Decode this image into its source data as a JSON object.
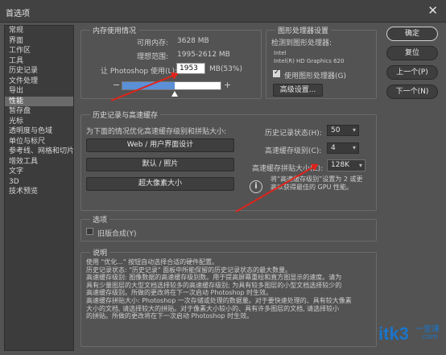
{
  "window": {
    "title": "首选项",
    "close_icon": "close-icon"
  },
  "sidebar": {
    "items": [
      {
        "label": "常规",
        "selected": false
      },
      {
        "label": "界面",
        "selected": false
      },
      {
        "label": "工作区",
        "selected": false
      },
      {
        "label": "工具",
        "selected": false
      },
      {
        "label": "历史记录",
        "selected": false
      },
      {
        "label": "文件处理",
        "selected": false
      },
      {
        "label": "导出",
        "selected": false
      },
      {
        "label": "性能",
        "selected": true
      },
      {
        "label": "暂存盘",
        "selected": false
      },
      {
        "label": "光标",
        "selected": false
      },
      {
        "label": "透明度与色域",
        "selected": false
      },
      {
        "label": "单位与标尺",
        "selected": false
      },
      {
        "label": "参考线、网格和切片",
        "selected": false
      },
      {
        "label": "增效工具",
        "selected": false
      },
      {
        "label": "文字",
        "selected": false
      },
      {
        "label": "3D",
        "selected": false
      },
      {
        "label": "技术预览",
        "selected": false
      }
    ]
  },
  "memory": {
    "legend": "内存使用情况",
    "available_label": "可用内存:",
    "available_value": "3628 MB",
    "ideal_label": "理想范围:",
    "ideal_value": "1995-2612 MB",
    "use_label": "让 Photoshop 使用(L):",
    "use_value": "1953",
    "use_unit": "MB(53%)",
    "minus": "−",
    "plus": "+",
    "slider_fraction": 0.53
  },
  "gpu": {
    "legend": "图形处理器设置",
    "detected_label": "检测到图形处理器:",
    "vendor": "Intel",
    "model": "Intel(R) HD Graphics 620",
    "use_gpu_label": "使用图形处理器(G)",
    "use_gpu_checked": true,
    "advanced_button": "高级设置..."
  },
  "history_cache": {
    "legend": "历史记录与高速缓存",
    "optimize_label": "为下面的情况优化高速缓存级别和拼贴大小:",
    "preset_buttons": [
      "Web / 用户界面设计",
      "默认 / 照片",
      "超大像素大小"
    ],
    "states_label": "历史记录状态(H):",
    "states_value": "50",
    "levels_label": "高速缓存级别(C):",
    "levels_value": "4",
    "tile_label": "高速缓存拼贴大小(Z):",
    "tile_value": "128K",
    "info_text_1": "将“高速缓存级别”设置为 2 或更",
    "info_text_2": "高以获得最佳的 GPU 性能。"
  },
  "options": {
    "legend": "选项",
    "legacy_compositing_label": "旧版合成(Y)",
    "legacy_compositing_checked": false
  },
  "description": {
    "legend": "说明",
    "lines": [
      "使用 \"优化...\" 按钮自动选择合适的硬件配置。",
      "历史记录状态: \"历史记录\" 面板中所能保留的历史记录状态的最大数量。",
      "高速缓存级别: 图像数据的高速缓存级别数。用于提高屏幕重绘和直方图显示的速度。请为",
      "具有少量图层的大型文档选择较多的高速缓存级别; 为具有较多图层的小型文档选择较少的",
      "高速缓存级别。所做的更改将在下一次启动 Photoshop 时生效。",
      "高速缓存拼贴大小: Photoshop 一次存储或处理的数据量。对于要快速处理的、具有较大像素",
      "大小的文档, 请选择较大的拼贴。对于像素大小较小的、具有许多图层的文档, 请选择较小",
      "的拼贴。所做的更改将在下一次启动 Photoshop 时生效。"
    ]
  },
  "actions": {
    "ok": "确定",
    "reset": "复位",
    "prev": "上一个(P)",
    "next": "下一个(N)"
  },
  "watermark": {
    "text": "itk3",
    "suffix": ".com",
    "cn": "一堂课"
  },
  "colors": {
    "annotation_arrow": "#e2231a",
    "slider_fill": "#5b8fd6",
    "watermark": "#1a75c9"
  }
}
